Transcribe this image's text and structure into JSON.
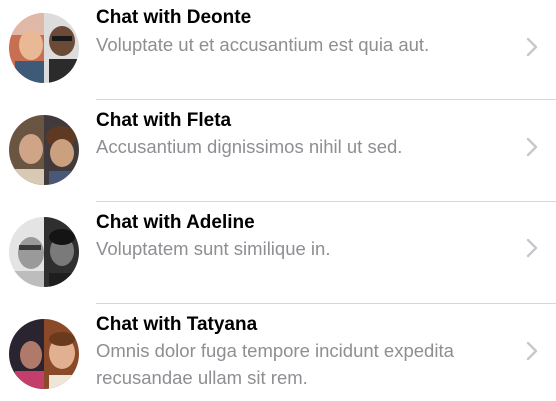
{
  "chats": [
    {
      "title": "Chat with Deonte",
      "preview": "Voluptate ut et accusantium est quia aut.",
      "avatar_left": "person-photo",
      "avatar_right": "person-photo"
    },
    {
      "title": "Chat with Fleta",
      "preview": "Accusantium dignissimos nihil ut sed.",
      "avatar_left": "person-photo",
      "avatar_right": "person-photo"
    },
    {
      "title": "Chat with Adeline",
      "preview": "Voluptatem sunt similique in.",
      "avatar_left": "person-photo",
      "avatar_right": "person-photo"
    },
    {
      "title": "Chat with Tatyana",
      "preview": "Omnis dolor fuga tempore incidunt expedita recusandae ullam sit rem.",
      "avatar_left": "person-photo",
      "avatar_right": "person-photo"
    }
  ],
  "colors": {
    "title": "#000000",
    "preview": "#8e8e93",
    "chevron": "#c7c7cc",
    "separator": "#d7d7db"
  },
  "icons": {
    "disclosure": "chevron-right-icon"
  }
}
